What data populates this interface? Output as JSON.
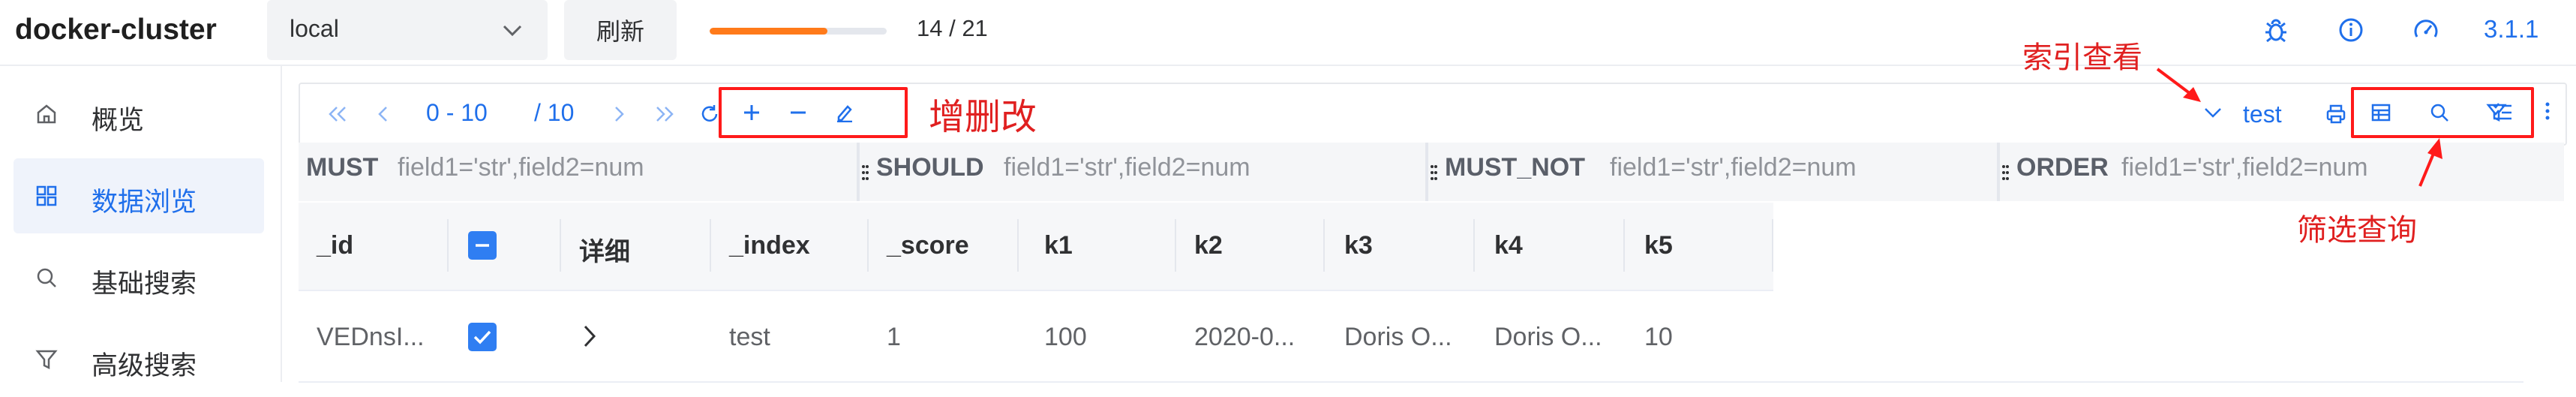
{
  "app": {
    "title": "docker-cluster",
    "version": "3.1.1"
  },
  "header": {
    "cluster_select": "local",
    "refresh_label": "刷新",
    "progress": {
      "current": 14,
      "total": 21,
      "text": "14 / 21",
      "fraction": 0.667
    }
  },
  "sidebar": {
    "items": [
      {
        "label": "概览",
        "icon": "home-icon",
        "active": false
      },
      {
        "label": "数据浏览",
        "icon": "grid-icon",
        "active": true
      },
      {
        "label": "基础搜索",
        "icon": "search-icon",
        "active": false
      },
      {
        "label": "高级搜索",
        "icon": "filter-icon",
        "active": false
      }
    ]
  },
  "toolbar": {
    "range_text": "0 - 10",
    "total_text": "/ 10",
    "index_name": "test",
    "annotations": {
      "crud": "增删改",
      "index_view": "索引查看",
      "filter_query": "筛选查询"
    }
  },
  "filters": [
    {
      "key": "MUST",
      "placeholder": "field1='str',field2=num"
    },
    {
      "key": "SHOULD",
      "placeholder": "field1='str',field2=num"
    },
    {
      "key": "MUST_NOT",
      "placeholder": "field1='str',field2=num"
    },
    {
      "key": "ORDER",
      "placeholder": "field1='str',field2=num"
    }
  ],
  "table": {
    "columns": [
      "_id",
      "",
      "详细",
      "_index",
      "_score",
      "k1",
      "k2",
      "k3",
      "k4",
      "k5"
    ],
    "rows": [
      {
        "_id": "VEDnsI...",
        "checked": true,
        "_index": "test",
        "_score": "1",
        "k1": "100",
        "k2": "2020-0...",
        "k3": "Doris O...",
        "k4": "Doris O...",
        "k5": "10"
      }
    ]
  },
  "colors": {
    "primary": "#1f6feb",
    "accent": "#ff7a1a",
    "annotation": "#ff1a1a"
  }
}
